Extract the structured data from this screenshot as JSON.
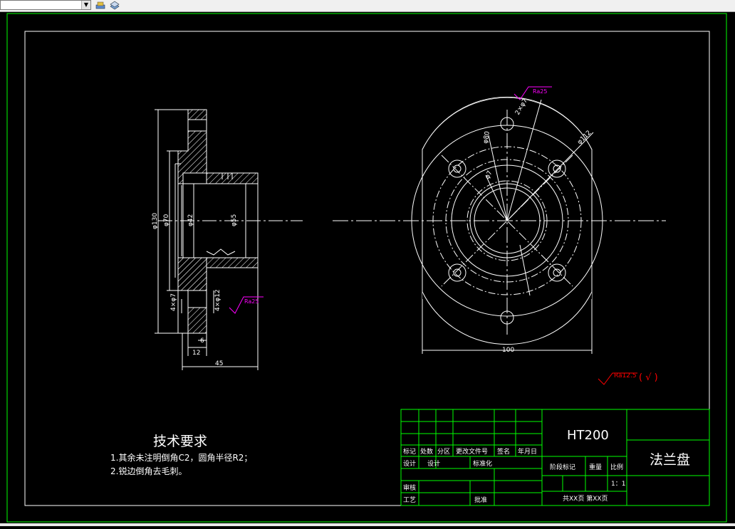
{
  "drawing": {
    "dims": {
      "d130": "φ130",
      "d70": "φ70",
      "d42": "φ42",
      "d55": "φ55",
      "hole_thru": "4×φ7",
      "hole_cb": "4×φ12",
      "w12": "12",
      "w6": "6",
      "w45": "45",
      "w100": "100",
      "pcd": "φ112",
      "ang": "2×φ7",
      "r50": "φ80",
      "bore": "φ7"
    },
    "roughness": {
      "ra25_top": "Ra25",
      "ra25_side": "Ra25",
      "general": "Ra12.5",
      "general_suffix": "( √ )"
    },
    "notes": {
      "title": "技术要求",
      "line1": "1.其余未注明倒角C2，圆角半径R2；",
      "line2": "2.锐边倒角去毛刺。"
    },
    "title_block": {
      "material": "HT200",
      "part_name": "法兰盘",
      "h_mark": "标记",
      "h_count": "处数",
      "h_zone": "分区",
      "h_doc": "更改文件号",
      "h_sign": "签名",
      "h_date": "年月日",
      "r_design": "设计",
      "r_design2": "设计",
      "r_std": "标准化",
      "r_stage": "阶段标记",
      "r_weight": "重量",
      "r_scale": "比例",
      "scale_val": "1：1",
      "r_check": "审核",
      "r_process": "工艺",
      "r_approve": "批准",
      "sheets": "共XX页  第XX页"
    }
  },
  "colors": {
    "line": "#ffffff",
    "frame": "#00ff00",
    "roughness_magenta": "#ff00ff",
    "roughness_red": "#ff0000"
  }
}
